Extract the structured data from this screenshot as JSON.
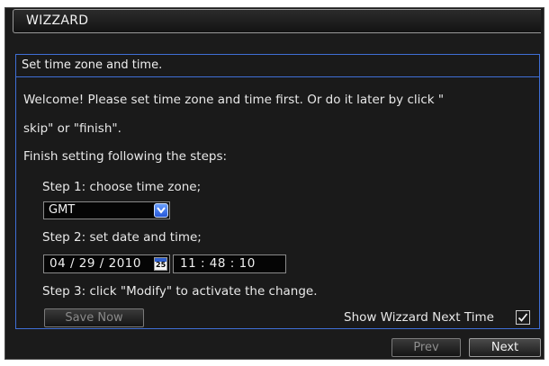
{
  "title": "WIZZARD",
  "panel": {
    "heading": "Set time zone and time.",
    "welcome_line1": "Welcome! Please set time zone and time first. Or do it later by click \"",
    "welcome_line2": "skip\" or \"finish\".",
    "finish_text": "Finish setting following the steps:",
    "step1": "Step 1: choose time zone;",
    "timezone": {
      "selected": "GMT"
    },
    "step2": "Step 2: set date and time;",
    "date": "04 / 29 / 2010",
    "calendar_day": "25",
    "time": "11  :  48  :  10",
    "step3": "Step 3: click \"Modify\" to activate the change.",
    "save_label": "Save Now",
    "show_wizard_label": "Show Wizzard Next Time",
    "show_wizard_checked": true
  },
  "footer": {
    "prev_label": "Prev",
    "next_label": "Next"
  },
  "colors": {
    "accent_border": "#3f6fd6",
    "background": "#1b1b1b",
    "text": "#e8e8e8"
  }
}
